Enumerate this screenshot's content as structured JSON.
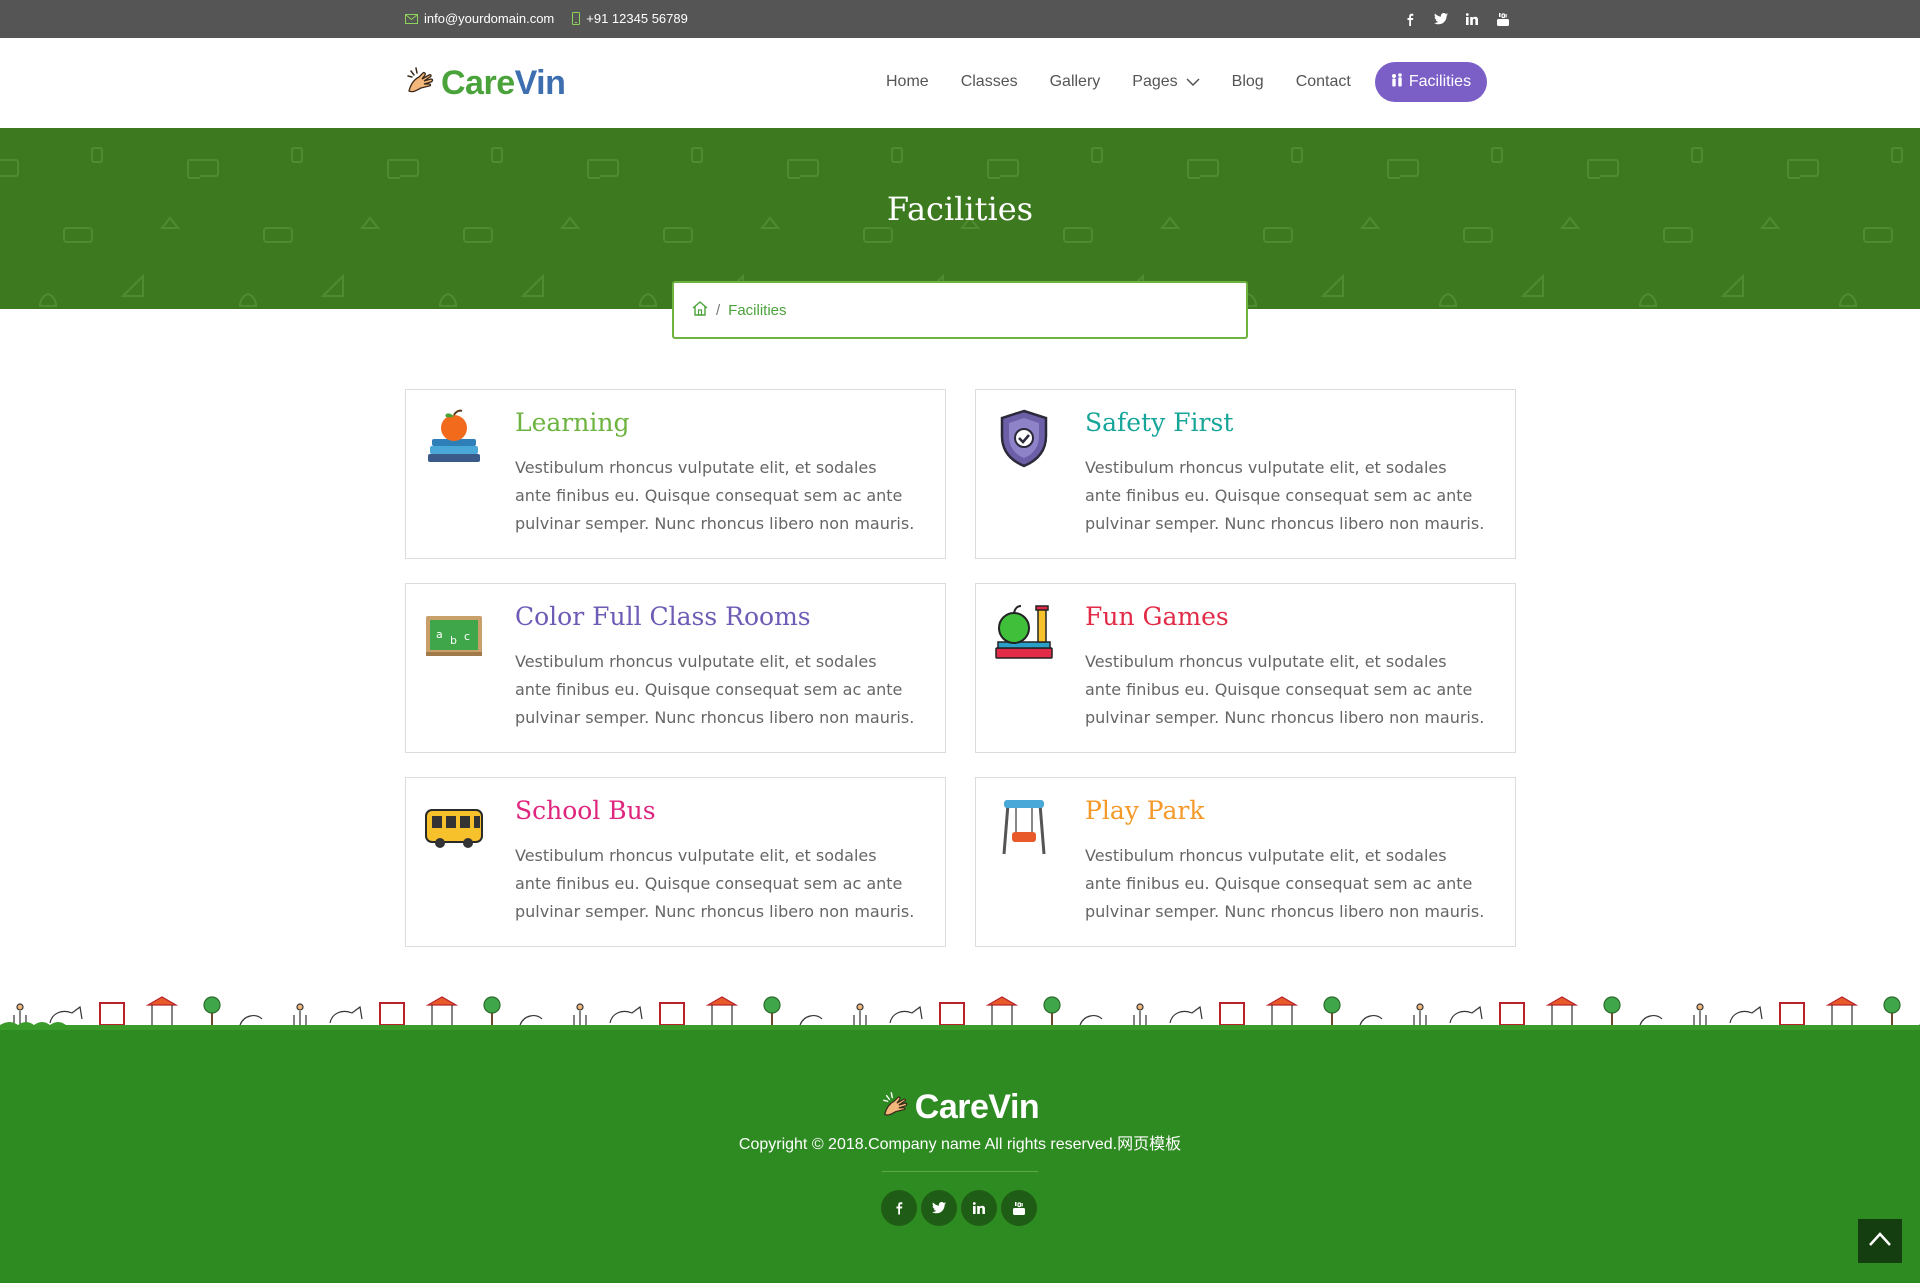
{
  "topbar": {
    "email": "info@yourdomain.com",
    "phone": "+91 12345 56789",
    "socials": [
      "facebook-icon",
      "twitter-icon",
      "linkedin-icon",
      "youtube-icon"
    ]
  },
  "header": {
    "logo_part1": "Care",
    "logo_part2": "Vin",
    "nav": {
      "home": "Home",
      "classes": "Classes",
      "gallery": "Gallery",
      "pages": "Pages",
      "blog": "Blog",
      "contact": "Contact",
      "facilities": "Facilities"
    }
  },
  "banner": {
    "title": "Facilities",
    "breadcrumb_current": "Facilities"
  },
  "cards": [
    {
      "title": "Learning",
      "color": "#6db33f",
      "text": "Vestibulum rhoncus vulputate elit, et sodales ante finibus eu. Quisque consequat sem ac ante pulvinar semper. Nunc rhoncus libero non mauris."
    },
    {
      "title": "Safety First",
      "color": "#17a59a",
      "text": "Vestibulum rhoncus vulputate elit, et sodales ante finibus eu. Quisque consequat sem ac ante pulvinar semper. Nunc rhoncus libero non mauris."
    },
    {
      "title": "Color Full Class Rooms",
      "color": "#6e5bb5",
      "text": "Vestibulum rhoncus vulputate elit, et sodales ante finibus eu. Quisque consequat sem ac ante pulvinar semper. Nunc rhoncus libero non mauris."
    },
    {
      "title": "Fun Games",
      "color": "#e22b47",
      "text": "Vestibulum rhoncus vulputate elit, et sodales ante finibus eu. Quisque consequat sem ac ante pulvinar semper. Nunc rhoncus libero non mauris."
    },
    {
      "title": "School Bus",
      "color": "#e0257f",
      "text": "Vestibulum rhoncus vulputate elit, et sodales ante finibus eu. Quisque consequat sem ac ante pulvinar semper. Nunc rhoncus libero non mauris."
    },
    {
      "title": "Play Park",
      "color": "#f39a2b",
      "text": "Vestibulum rhoncus vulputate elit, et sodales ante finibus eu. Quisque consequat sem ac ante pulvinar semper. Nunc rhoncus libero non mauris."
    }
  ],
  "footer": {
    "logo": "CareVin",
    "copyright": "Copyright © 2018.Company name All rights reserved.网页模板",
    "socials": [
      "facebook-icon",
      "twitter-icon",
      "linkedin-icon",
      "youtube-icon"
    ]
  },
  "colors": {
    "topbar": "#555555",
    "banner": "#3d7a1f",
    "footer": "#2e8b22",
    "accent_green": "#6db33f",
    "cta_purple": "#7b5fc7"
  }
}
